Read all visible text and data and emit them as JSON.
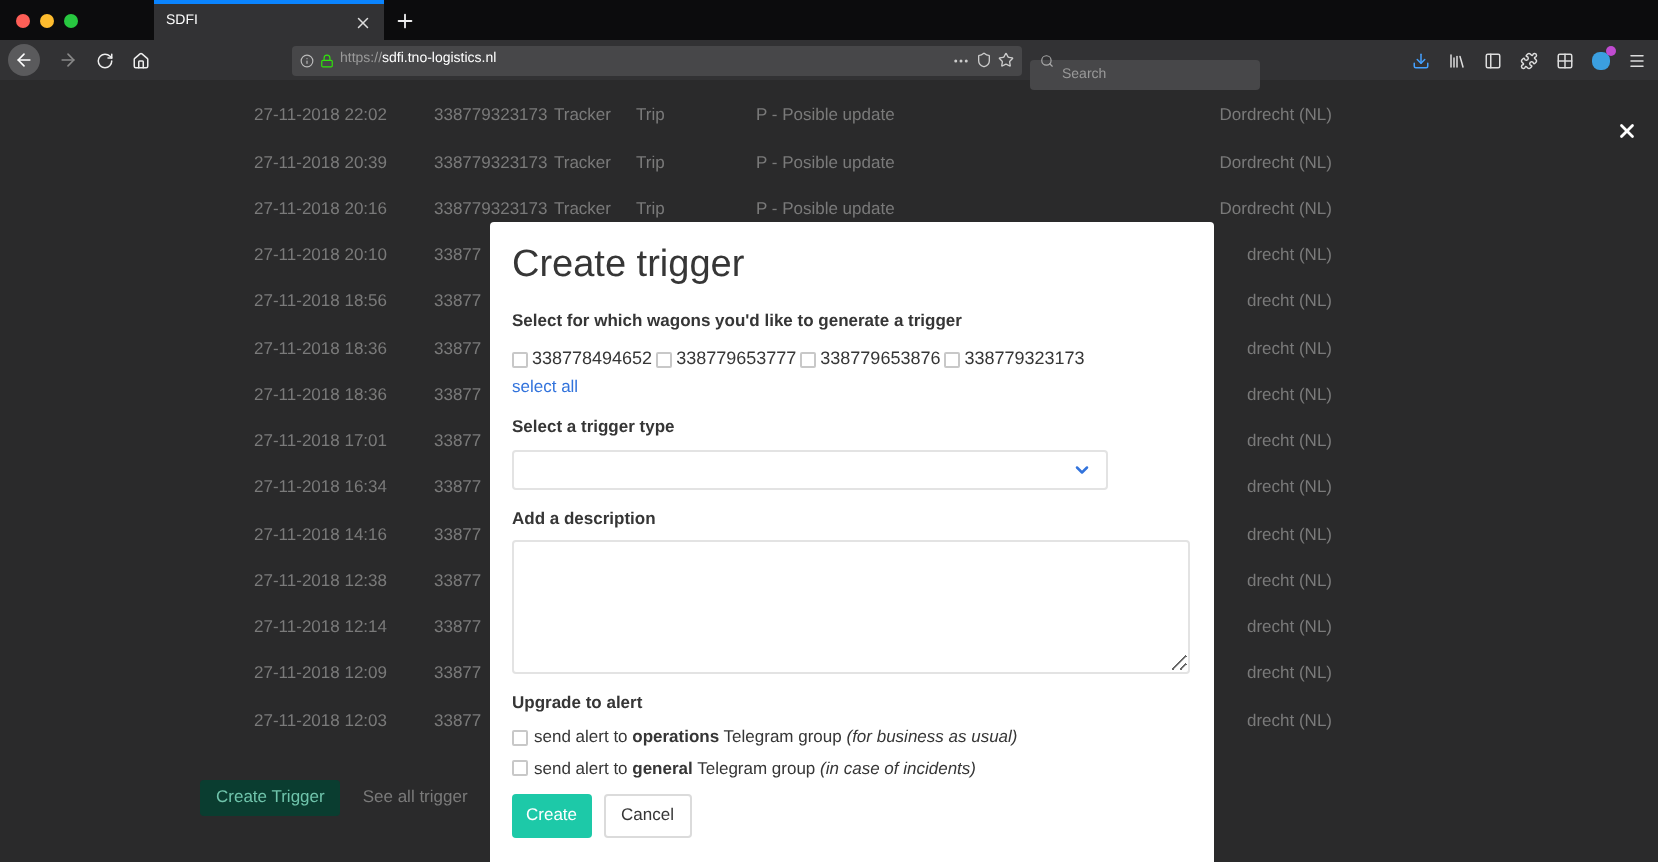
{
  "browser": {
    "tab": {
      "title": "SDFI"
    },
    "url": {
      "scheme": "https://",
      "host": "sdfi.tno-logistics.nl"
    },
    "search": {
      "placeholder": "Search"
    }
  },
  "table": {
    "rows": [
      {
        "date": "27-11-2018 22:02",
        "wagon": "338779323173",
        "column_3": "Tracker",
        "column_4": "Trip",
        "column_5": "P - Posible update",
        "location": "Dordrecht (NL)"
      },
      {
        "date": "27-11-2018 20:39",
        "wagon": "338779323173",
        "column_3": "Tracker",
        "column_4": "Trip",
        "column_5": "P - Posible update",
        "location": "Dordrecht (NL)"
      },
      {
        "date": "27-11-2018 20:16",
        "wagon": "338779323173",
        "column_3": "Tracker",
        "column_4": "Trip",
        "column_5": "P - Posible update",
        "location": "Dordrecht (NL)"
      },
      {
        "date": "27-11-2018 20:10",
        "wagon": "33877",
        "location": "drecht (NL)"
      },
      {
        "date": "27-11-2018 18:56",
        "wagon": "33877",
        "location": "drecht (NL)"
      },
      {
        "date": "27-11-2018 18:36",
        "wagon": "33877",
        "location": "drecht (NL)"
      },
      {
        "date": "27-11-2018 18:36",
        "wagon": "33877",
        "location": "drecht (NL)"
      },
      {
        "date": "27-11-2018 17:01",
        "wagon": "33877",
        "location": "drecht (NL)"
      },
      {
        "date": "27-11-2018 16:34",
        "wagon": "33877",
        "location": "drecht (NL)"
      },
      {
        "date": "27-11-2018 14:16",
        "wagon": "33877",
        "location": "drecht (NL)"
      },
      {
        "date": "27-11-2018 12:38",
        "wagon": "33877",
        "location": "drecht (NL)"
      },
      {
        "date": "27-11-2018 12:14",
        "wagon": "33877",
        "location": "drecht (NL)"
      },
      {
        "date": "27-11-2018 12:09",
        "wagon": "33877",
        "location": "drecht (NL)"
      },
      {
        "date": "27-11-2018 12:03",
        "wagon": "33877",
        "location": "drecht (NL)"
      }
    ]
  },
  "actions": {
    "create_trigger": "Create Trigger",
    "see_all": "See all trigger"
  },
  "modal": {
    "title": "Create trigger",
    "wagons": {
      "label": "Select for which wagons you'd like to generate a trigger",
      "options": [
        {
          "label": "338778494652",
          "checked": false
        },
        {
          "label": "338779653777",
          "checked": false
        },
        {
          "label": "338779653876",
          "checked": false
        },
        {
          "label": "338779323173",
          "checked": false
        }
      ],
      "select_all": "select all"
    },
    "trigger_type": {
      "label": "Select a trigger type"
    },
    "description": {
      "label": "Add a description"
    },
    "alert": {
      "label": "Upgrade to alert",
      "options": [
        {
          "label": "send alert to **operations** Telegram group *(for business as usual)*",
          "checked": false
        },
        {
          "label": "send alert to **general** Telegram group *(in case of incidents)*",
          "checked": false
        }
      ]
    },
    "buttons": {
      "create": "Create",
      "cancel": "Cancel"
    }
  }
}
